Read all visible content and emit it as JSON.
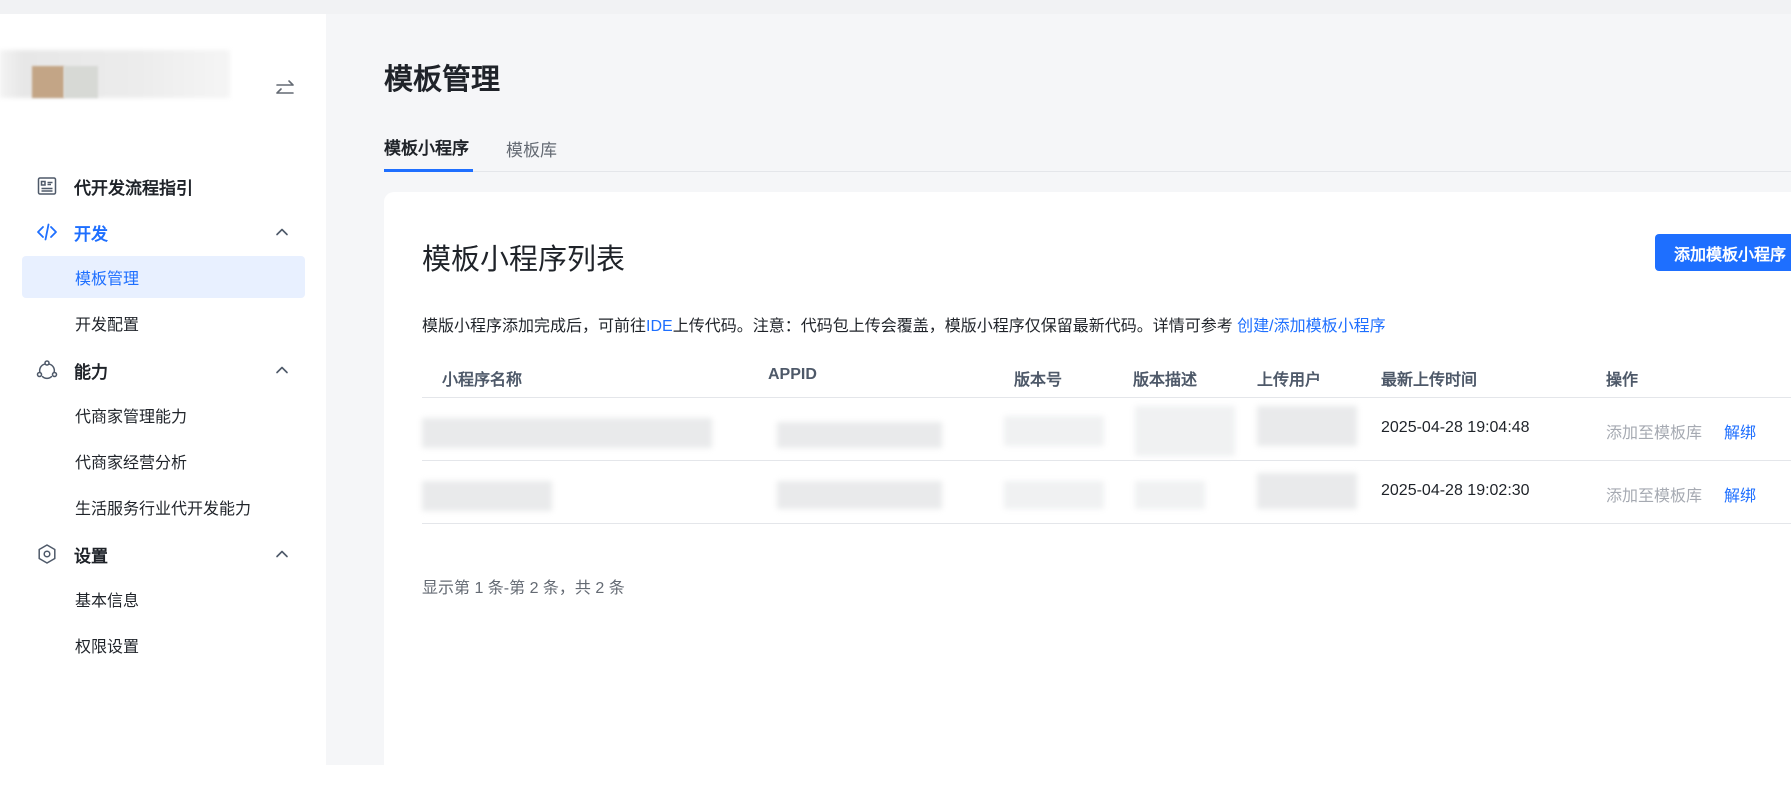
{
  "sidebar": {
    "collapse_icon": "collapse-arrows-icon",
    "guide": {
      "label": "代开发流程指引",
      "icon": "guide-list-icon"
    },
    "groups": [
      {
        "label": "开发",
        "icon": "code-icon",
        "expanded": true,
        "items": [
          "模板管理",
          "开发配置"
        ]
      },
      {
        "label": "能力",
        "icon": "capability-icon",
        "expanded": true,
        "items": [
          "代商家管理能力",
          "代商家经营分析",
          "生活服务行业代开发能力"
        ]
      },
      {
        "label": "设置",
        "icon": "settings-icon",
        "expanded": true,
        "items": [
          "基本信息",
          "权限设置"
        ]
      }
    ],
    "active_item": "模板管理"
  },
  "main": {
    "title": "模板管理",
    "tabs": [
      {
        "label": "模板小程序",
        "active": true
      },
      {
        "label": "模板库",
        "active": false
      }
    ],
    "card": {
      "title": "模板小程序列表",
      "add_button": "添加模板小程序",
      "notice": {
        "text1": "模版小程序添加完成后，可前往",
        "ide_link": "IDE",
        "text2": "上传代码。注意：代码包上传会覆盖，模版小程序仅保留最新代码。详情可参考 ",
        "doc_link": "创建/添加模板小程序"
      },
      "table": {
        "columns": [
          "小程序名称",
          "APPID",
          "版本号",
          "版本描述",
          "上传用户",
          "最新上传时间",
          "操作"
        ],
        "rows": [
          {
            "upload_time": "2025-04-28 19:04:48",
            "op_add": "添加至模板库",
            "op_unbind": "解绑"
          },
          {
            "upload_time": "2025-04-28 19:02:30",
            "op_add": "添加至模板库",
            "op_unbind": "解绑"
          }
        ]
      },
      "pagination": "显示第 1 条-第 2 条，共 2 条"
    }
  },
  "colors": {
    "accent": "#1e6fff",
    "active_bg": "#e8f0ff",
    "disabled_text": "#a6aab2"
  }
}
